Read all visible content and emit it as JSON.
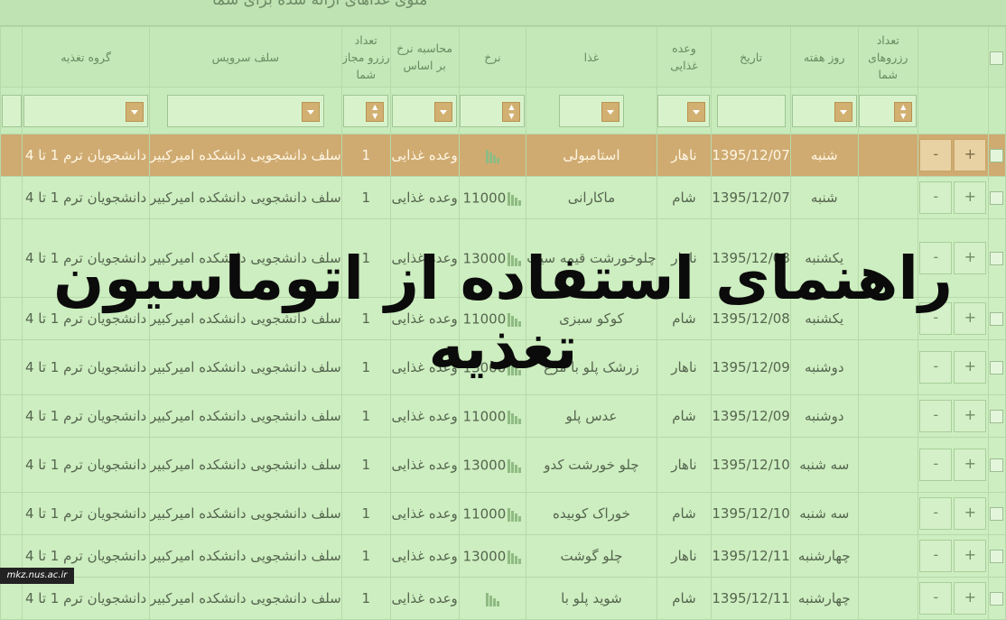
{
  "menu_title": "منوی غذاهای ارائه شده برای شما",
  "headers": {
    "reserve_count": "تعداد رزروهای شما",
    "weekday": "روز هفته",
    "date": "تاریخ",
    "meal": "وعده غذایی",
    "food": "غذا",
    "price": "نرخ",
    "price_basis": "محاسبه نرخ بر اساس",
    "allowed": "تعداد رزرو مجاز شما",
    "service": "سلف سرویس",
    "group": "گروه تغذیه"
  },
  "buttons": {
    "plus": "+",
    "minus": "-"
  },
  "rows": [
    {
      "weekday": "شنبه",
      "date": "1395/12/07",
      "meal": "ناهار",
      "food": "استامبولی",
      "price": "",
      "basis": "وعده غذایی",
      "allowed": "1",
      "service": "سلف دانشجویی دانشکده امیرکبیر",
      "group": "دانشجویان ترم 1 تا 4"
    },
    {
      "weekday": "شنبه",
      "date": "1395/12/07",
      "meal": "شام",
      "food": "ماکارانی",
      "price": "11000",
      "basis": "وعده غذایی",
      "allowed": "1",
      "service": "سلف دانشجویی دانشکده امیرکبیر",
      "group": "دانشجویان ترم 1 تا 4"
    },
    {
      "weekday": "یکشنبه",
      "date": "1395/12/08",
      "meal": "ناهار",
      "food": "چلوخورشت قیمه سیب",
      "price": "13000",
      "basis": "وعده غذایی",
      "allowed": "1",
      "service": "سلف دانشجویی دانشکده امیرکبیر",
      "group": "دانشجویان ترم 1 تا 4"
    },
    {
      "weekday": "یکشنبه",
      "date": "1395/12/08",
      "meal": "شام",
      "food": "کوکو سبزی",
      "price": "11000",
      "basis": "وعده غذایی",
      "allowed": "1",
      "service": "سلف دانشجویی دانشکده امیرکبیر",
      "group": "دانشجویان ترم 1 تا 4"
    },
    {
      "weekday": "دوشنبه",
      "date": "1395/12/09",
      "meal": "ناهار",
      "food": "زرشک پلو با مرغ",
      "price": "13000",
      "basis": "وعده غذایی",
      "allowed": "1",
      "service": "سلف دانشجویی دانشکده امیرکبیر",
      "group": "دانشجویان ترم 1 تا 4"
    },
    {
      "weekday": "دوشنبه",
      "date": "1395/12/09",
      "meal": "شام",
      "food": "عدس پلو",
      "price": "11000",
      "basis": "وعده غذایی",
      "allowed": "1",
      "service": "سلف دانشجویی دانشکده امیرکبیر",
      "group": "دانشجویان ترم 1 تا 4"
    },
    {
      "weekday": "سه شنبه",
      "date": "1395/12/10",
      "meal": "ناهار",
      "food": "چلو خورشت کدو",
      "price": "13000",
      "basis": "وعده غذایی",
      "allowed": "1",
      "service": "سلف دانشجویی دانشکده امیرکبیر",
      "group": "دانشجویان ترم 1 تا 4"
    },
    {
      "weekday": "سه شنبه",
      "date": "1395/12/10",
      "meal": "شام",
      "food": "خوراک کوبیده",
      "price": "11000",
      "basis": "وعده غذایی",
      "allowed": "1",
      "service": "سلف دانشجویی دانشکده امیرکبیر",
      "group": "دانشجویان ترم 1 تا 4"
    },
    {
      "weekday": "چهارشنبه",
      "date": "1395/12/11",
      "meal": "ناهار",
      "food": "چلو گوشت",
      "price": "13000",
      "basis": "وعده غذایی",
      "allowed": "1",
      "service": "سلف دانشجویی دانشکده امیرکبیر",
      "group": "دانشجویان ترم 1 تا 4"
    },
    {
      "weekday": "چهارشنبه",
      "date": "1395/12/11",
      "meal": "شام",
      "food": "شوید پلو با",
      "price": "",
      "basis": "وعده غذایی",
      "allowed": "1",
      "service": "سلف دانشجویی دانشکده امیرکبیر",
      "group": "دانشجویان ترم 1 تا 4"
    }
  ],
  "banner_title": "راهنمای استفاده از اتوماسیون تغذیه",
  "watermark": "mkz.nus.ac.ir"
}
